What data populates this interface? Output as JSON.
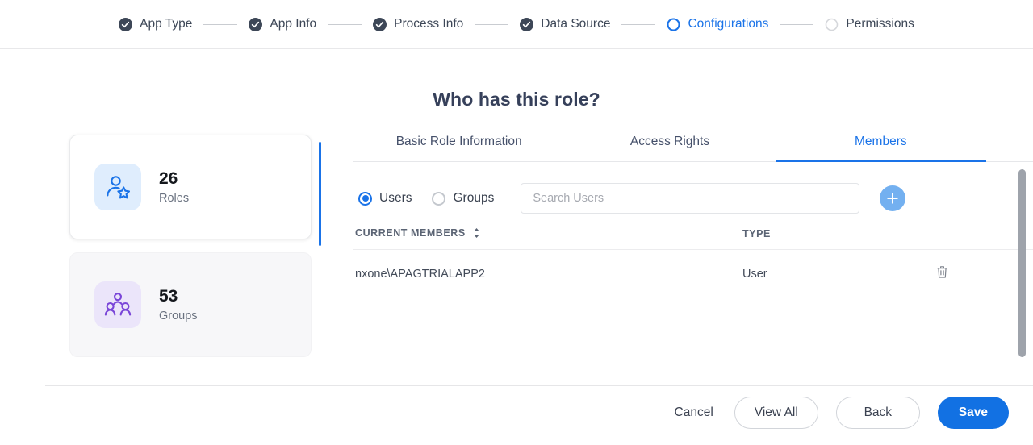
{
  "stepper": {
    "steps": [
      {
        "label": "App Type",
        "state": "complete"
      },
      {
        "label": "App Info",
        "state": "complete"
      },
      {
        "label": "Process Info",
        "state": "complete"
      },
      {
        "label": "Data Source",
        "state": "complete"
      },
      {
        "label": "Configurations",
        "state": "active"
      },
      {
        "label": "Permissions",
        "state": "upcoming"
      }
    ]
  },
  "page": {
    "title": "Who has this role?"
  },
  "stats": [
    {
      "count": "26",
      "label": "Roles",
      "icon": "user-star-icon",
      "accent": "#1a73e8",
      "tile": "#dfedfd",
      "selected": true
    },
    {
      "count": "53",
      "label": "Groups",
      "icon": "user-group-icon",
      "accent": "#7a46d8",
      "tile": "#ebe5fa",
      "selected": false
    }
  ],
  "tabs": [
    {
      "label": "Basic Role Information",
      "active": false
    },
    {
      "label": "Access Rights",
      "active": false
    },
    {
      "label": "Members",
      "active": true
    }
  ],
  "members_panel": {
    "radio": {
      "users_label": "Users",
      "groups_label": "Groups",
      "selected": "Users"
    },
    "search": {
      "placeholder": "Search Users",
      "value": ""
    },
    "add_button_icon": "plus-icon",
    "columns": {
      "name": "CURRENT MEMBERS",
      "type": "TYPE"
    },
    "rows": [
      {
        "name": "nxone\\APAGTRIALAPP2",
        "type": "User",
        "action_icon": "trash-icon"
      }
    ]
  },
  "footer": {
    "cancel": "Cancel",
    "view_all": "View All",
    "back": "Back",
    "save": "Save"
  },
  "colors": {
    "accent": "#1a73e8",
    "primary_button": "#1271e3",
    "roles_accent": "#1a73e8",
    "groups_accent": "#7a46d8"
  }
}
